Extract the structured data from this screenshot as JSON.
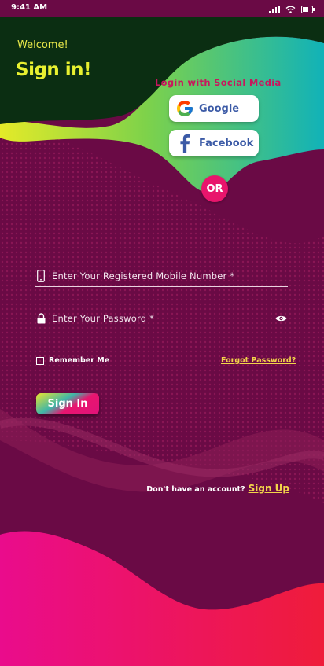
{
  "status_bar": {
    "time": "9:41 AM",
    "icons": [
      "signal-icon",
      "wifi-icon",
      "battery-icon"
    ]
  },
  "header": {
    "welcome": "Welcome!",
    "title": "Sign in!"
  },
  "social": {
    "title": "Login with Social Media",
    "google_label": "Google",
    "facebook_label": "Facebook"
  },
  "divider": {
    "or_label": "OR"
  },
  "form": {
    "mobile_placeholder": "Enter Your Registered Mobile Number *",
    "mobile_value": "",
    "password_placeholder": "Enter Your Password *",
    "password_value": "",
    "remember_label": "Remember Me",
    "remember_checked": false,
    "forgot_label": "Forgot Password?",
    "submit_label": "Sign In"
  },
  "footer": {
    "prompt": "Don't have an account?",
    "signup_label": "Sign Up"
  },
  "colors": {
    "background": "#6a0a45",
    "header_dark": "#0b2e12",
    "accent_yellow": "#e8f030",
    "accent_pink": "#e8156c",
    "link_yellow": "#f3d54a",
    "social_title": "#c8175d",
    "facebook_blue": "#3b5aa6"
  }
}
